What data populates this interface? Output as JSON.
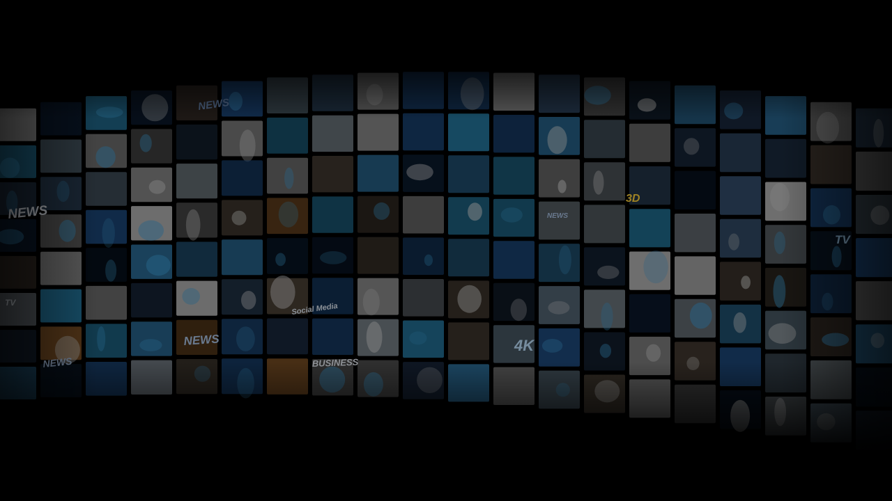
{
  "scene": {
    "description_alt": "",
    "tile_labels": {
      "news": "NEWS",
      "tv": "TV",
      "social_media": "Social Media",
      "business": "BUSINESS",
      "four_k": "4K",
      "three_d": "3D"
    }
  },
  "colors": {
    "background": "#000000",
    "tile_dark": "#0b1a2e",
    "tile_blue": "#1f4f86",
    "tile_cyan": "#2a8bb8",
    "tile_warm": "#8a5a2a",
    "tile_gray": "#6b6b6b",
    "tile_light": "#b8b8b8",
    "label_white": "#e8eef5"
  }
}
